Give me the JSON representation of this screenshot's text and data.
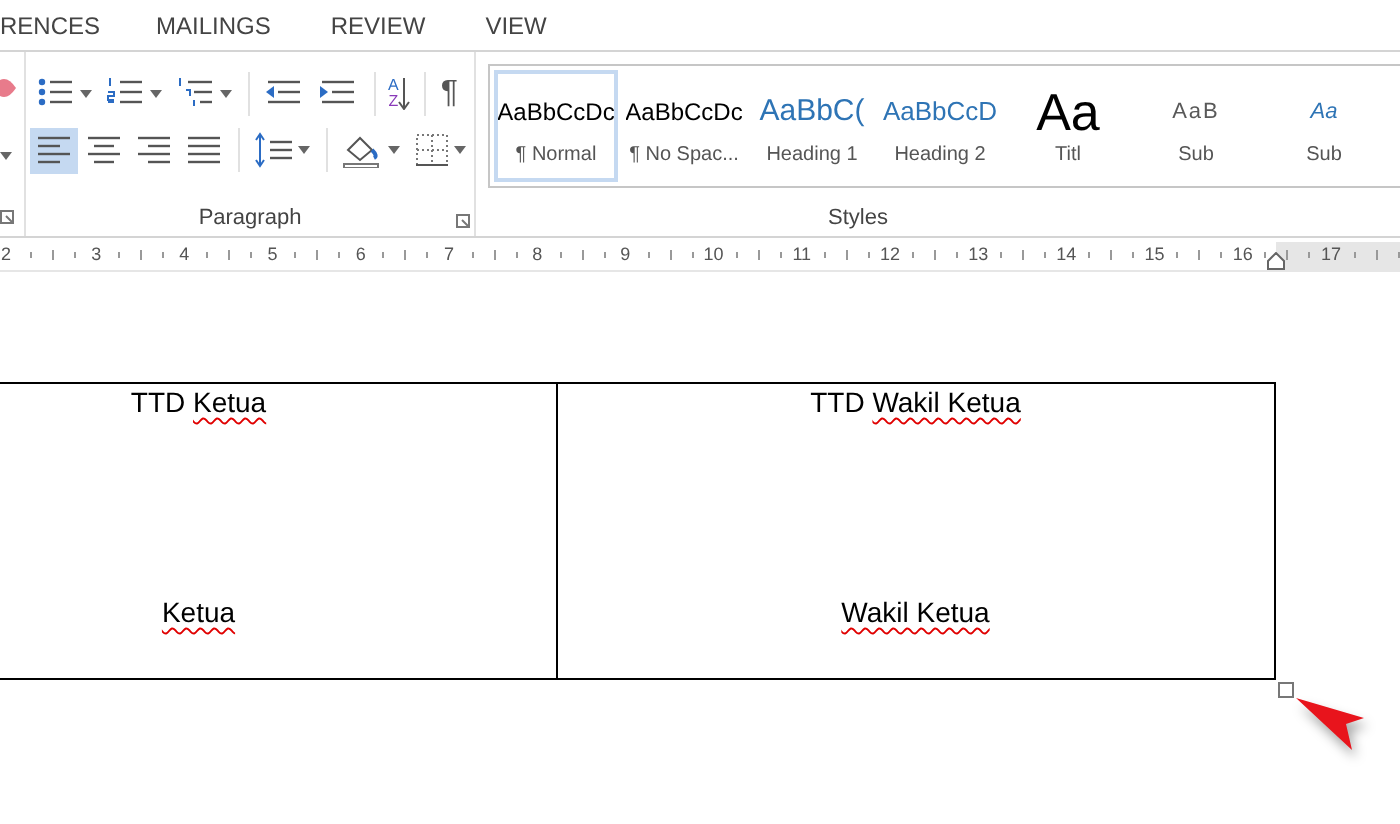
{
  "tabs": [
    {
      "label": "RENCES",
      "selected": false
    },
    {
      "label": "MAILINGS",
      "selected": false
    },
    {
      "label": "REVIEW",
      "selected": false
    },
    {
      "label": "VIEW",
      "selected": false
    }
  ],
  "paragraph": {
    "label": "Paragraph",
    "rows": [
      [
        {
          "kind": "bullets",
          "dropdown": true,
          "selected": false
        },
        {
          "kind": "numbering",
          "dropdown": true,
          "selected": false
        },
        {
          "kind": "multilevel",
          "dropdown": true,
          "selected": false
        },
        {
          "kind": "sep"
        },
        {
          "kind": "outdent",
          "dropdown": false,
          "selected": false
        },
        {
          "kind": "indent",
          "dropdown": false,
          "selected": false
        },
        {
          "kind": "sep"
        },
        {
          "kind": "sort",
          "letters": [
            "A",
            "Z"
          ],
          "dropdown": false,
          "selected": false
        },
        {
          "kind": "sep"
        },
        {
          "kind": "glyph",
          "glyph": "¶",
          "dropdown": false,
          "selected": false
        }
      ],
      [
        {
          "kind": "align-left",
          "dropdown": false,
          "selected": true
        },
        {
          "kind": "align-center",
          "dropdown": false,
          "selected": false
        },
        {
          "kind": "align-right",
          "dropdown": false,
          "selected": false
        },
        {
          "kind": "justify",
          "dropdown": false,
          "selected": false
        },
        {
          "kind": "sep"
        },
        {
          "kind": "spacing",
          "dropdown": true,
          "selected": false
        },
        {
          "kind": "sep"
        },
        {
          "kind": "shading",
          "dropdown": true,
          "selected": false
        },
        {
          "kind": "borders",
          "dropdown": true,
          "selected": false
        }
      ]
    ]
  },
  "styles": {
    "label": "Styles",
    "items": [
      {
        "kind": "normal",
        "preview": "AaBbCcDc",
        "name": "¶ Normal",
        "selected": true
      },
      {
        "kind": "normal",
        "preview": "AaBbCcDc",
        "name": "¶ No Spac...",
        "selected": false
      },
      {
        "kind": "heading1",
        "preview": "AaBbC(",
        "name": "Heading 1",
        "selected": false
      },
      {
        "kind": "heading2",
        "preview": "AaBbCcD",
        "name": "Heading 2",
        "selected": false
      },
      {
        "kind": "title",
        "preview": "Aa",
        "name": "Titl",
        "selected": false
      },
      {
        "kind": "subtitle",
        "preview": "AaB",
        "name": "Sub",
        "selected": false
      },
      {
        "kind": "emphasis",
        "preview": "Aa",
        "name": "Sub",
        "selected": false
      }
    ]
  },
  "ruler": {
    "numbers": [
      "2",
      "3",
      "4",
      "5",
      "6",
      "7",
      "8",
      "9",
      "10",
      "11",
      "12",
      "13",
      "14",
      "15",
      "16",
      "17"
    ]
  },
  "table": {
    "cells": [
      {
        "top": [
          {
            "text": "TTD",
            "misspelled": false
          },
          {
            "text": "Ketua",
            "misspelled": true
          }
        ],
        "bottom": [
          {
            "text": "Ketua",
            "misspelled": true
          }
        ]
      },
      {
        "top": [
          {
            "text": "TTD",
            "misspelled": false
          },
          {
            "text": "Wakil Ketua",
            "misspelled": true
          }
        ],
        "bottom": [
          {
            "text": "Wakil Ketua",
            "misspelled": true
          }
        ]
      }
    ]
  }
}
